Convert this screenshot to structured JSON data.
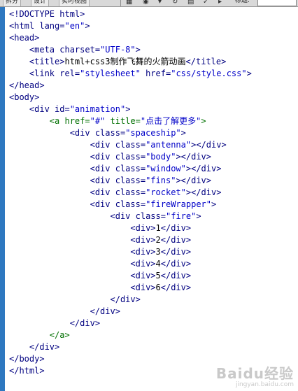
{
  "toolbar": {
    "buttons": [
      "拆分",
      "设计",
      "实时视图"
    ],
    "title_label": "标题:"
  },
  "code_lines": [
    [
      {
        "t": "<!DOCTYPE html>",
        "c": "tag"
      }
    ],
    [
      {
        "t": "<html lang=",
        "c": "tag"
      },
      {
        "t": "\"en\"",
        "c": "val"
      },
      {
        "t": ">",
        "c": "tag"
      }
    ],
    [
      {
        "t": "<head>",
        "c": "tag"
      }
    ],
    [
      {
        "t": "    "
      },
      {
        "t": "<meta charset=",
        "c": "tag"
      },
      {
        "t": "\"UTF-8\"",
        "c": "val"
      },
      {
        "t": ">",
        "c": "tag"
      }
    ],
    [
      {
        "t": "    "
      },
      {
        "t": "<title>",
        "c": "tag"
      },
      {
        "t": "html+css3制作飞舞的火箭动画",
        "c": "txt"
      },
      {
        "t": "</title>",
        "c": "tag"
      }
    ],
    [
      {
        "t": "    "
      },
      {
        "t": "<link rel=",
        "c": "tag"
      },
      {
        "t": "\"stylesheet\"",
        "c": "val"
      },
      {
        "t": " href=",
        "c": "tag"
      },
      {
        "t": "\"css/style.css\"",
        "c": "val"
      },
      {
        "t": ">",
        "c": "tag"
      }
    ],
    [
      {
        "t": "</head>",
        "c": "tag"
      }
    ],
    [
      {
        "t": "<body>",
        "c": "tag"
      }
    ],
    [
      {
        "t": "    "
      },
      {
        "t": "<div id=",
        "c": "tag"
      },
      {
        "t": "\"animation\"",
        "c": "val"
      },
      {
        "t": ">",
        "c": "tag"
      }
    ],
    [
      {
        "t": "        "
      },
      {
        "t": "<a href=",
        "c": "anchor"
      },
      {
        "t": "\"#\"",
        "c": "val"
      },
      {
        "t": " title=",
        "c": "anchor"
      },
      {
        "t": "\"点击了解更多\"",
        "c": "val"
      },
      {
        "t": ">",
        "c": "anchor"
      }
    ],
    [
      {
        "t": "            "
      },
      {
        "t": "<div class=",
        "c": "tag"
      },
      {
        "t": "\"spaceship\"",
        "c": "val"
      },
      {
        "t": ">",
        "c": "tag"
      }
    ],
    [
      {
        "t": "                "
      },
      {
        "t": "<div class=",
        "c": "tag"
      },
      {
        "t": "\"antenna\"",
        "c": "val"
      },
      {
        "t": "></div>",
        "c": "tag"
      }
    ],
    [
      {
        "t": "                "
      },
      {
        "t": "<div class=",
        "c": "tag"
      },
      {
        "t": "\"body\"",
        "c": "val"
      },
      {
        "t": "></div>",
        "c": "tag"
      }
    ],
    [
      {
        "t": "                "
      },
      {
        "t": "<div class=",
        "c": "tag"
      },
      {
        "t": "\"window\"",
        "c": "val"
      },
      {
        "t": "></div>",
        "c": "tag"
      }
    ],
    [
      {
        "t": "                "
      },
      {
        "t": "<div class=",
        "c": "tag"
      },
      {
        "t": "\"fins\"",
        "c": "val"
      },
      {
        "t": "></div>",
        "c": "tag"
      }
    ],
    [
      {
        "t": "                "
      },
      {
        "t": "<div class=",
        "c": "tag"
      },
      {
        "t": "\"rocket\"",
        "c": "val"
      },
      {
        "t": "></div>",
        "c": "tag"
      }
    ],
    [
      {
        "t": "                "
      },
      {
        "t": "<div class=",
        "c": "tag"
      },
      {
        "t": "\"fireWrapper\"",
        "c": "val"
      },
      {
        "t": ">",
        "c": "tag"
      }
    ],
    [
      {
        "t": "                    "
      },
      {
        "t": "<div class=",
        "c": "tag"
      },
      {
        "t": "\"fire\"",
        "c": "val"
      },
      {
        "t": ">",
        "c": "tag"
      }
    ],
    [
      {
        "t": "                        "
      },
      {
        "t": "<div>",
        "c": "tag"
      },
      {
        "t": "1",
        "c": "txt"
      },
      {
        "t": "</div>",
        "c": "tag"
      }
    ],
    [
      {
        "t": "                        "
      },
      {
        "t": "<div>",
        "c": "tag"
      },
      {
        "t": "2",
        "c": "txt"
      },
      {
        "t": "</div>",
        "c": "tag"
      }
    ],
    [
      {
        "t": "                        "
      },
      {
        "t": "<div>",
        "c": "tag"
      },
      {
        "t": "3",
        "c": "txt"
      },
      {
        "t": "</div>",
        "c": "tag"
      }
    ],
    [
      {
        "t": "                        "
      },
      {
        "t": "<div>",
        "c": "tag"
      },
      {
        "t": "4",
        "c": "txt"
      },
      {
        "t": "</div>",
        "c": "tag"
      }
    ],
    [
      {
        "t": "                        "
      },
      {
        "t": "<div>",
        "c": "tag"
      },
      {
        "t": "5",
        "c": "txt"
      },
      {
        "t": "</div>",
        "c": "tag"
      }
    ],
    [
      {
        "t": "                        "
      },
      {
        "t": "<div>",
        "c": "tag"
      },
      {
        "t": "6",
        "c": "txt"
      },
      {
        "t": "</div>",
        "c": "tag"
      }
    ],
    [
      {
        "t": "                    "
      },
      {
        "t": "</div>",
        "c": "tag"
      }
    ],
    [
      {
        "t": "                "
      },
      {
        "t": "</div>",
        "c": "tag"
      }
    ],
    [
      {
        "t": "            "
      },
      {
        "t": "</div>",
        "c": "tag"
      }
    ],
    [
      {
        "t": "        "
      },
      {
        "t": "</a>",
        "c": "anchor"
      }
    ],
    [
      {
        "t": "    "
      },
      {
        "t": "</div>",
        "c": "tag"
      }
    ],
    [
      {
        "t": "</body>",
        "c": "tag"
      }
    ],
    [
      {
        "t": "</html>",
        "c": "tag"
      }
    ]
  ],
  "watermark": {
    "brand": "Baidu经验",
    "url": "jingyan.baidu.com"
  }
}
